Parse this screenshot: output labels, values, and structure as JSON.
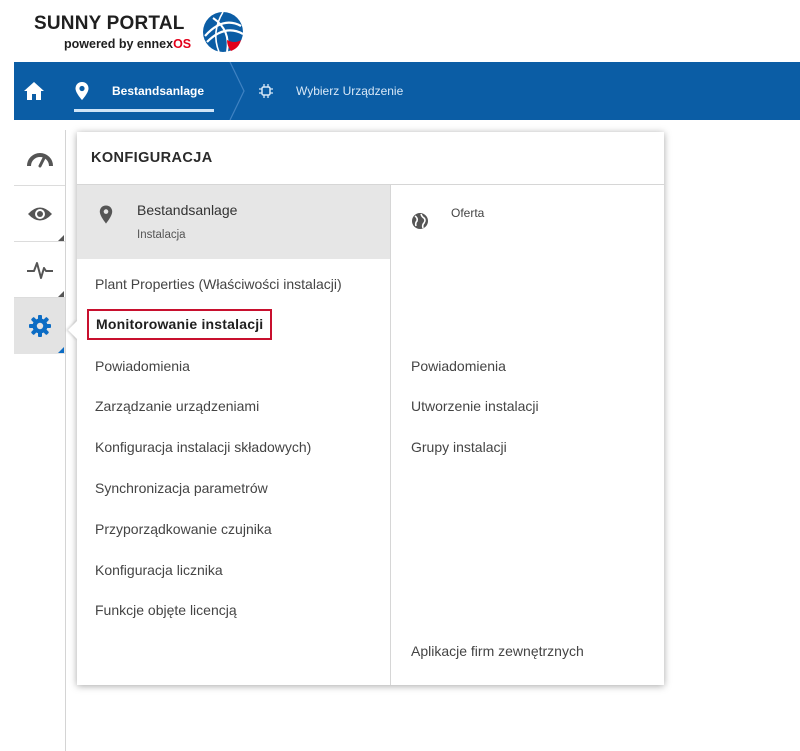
{
  "logo": {
    "title": "SUNNY PORTAL",
    "subtitle_prefix": "powered by ennex",
    "subtitle_suffix": "OS"
  },
  "topnav": {
    "home_icon": "home-icon",
    "breadcrumb": [
      {
        "label": "Bestandsanlage",
        "icon": "location-pin-icon",
        "active": true
      },
      {
        "label": "Wybierz Urządzenie",
        "icon": "device-chip-icon",
        "active": false
      }
    ]
  },
  "rail": {
    "items": [
      {
        "icon": "dashboard-gauge-icon",
        "active": false
      },
      {
        "icon": "eye-icon",
        "active": false
      },
      {
        "icon": "pulse-icon",
        "active": false
      },
      {
        "icon": "gear-icon",
        "active": true
      }
    ]
  },
  "popup": {
    "title": "KONFIGURACJA",
    "plant": {
      "name": "Bestandsanlage",
      "type": "Instalacja"
    },
    "left_items": [
      "Plant Properties (Właściwości instalacji)",
      "Monitorowanie instalacji",
      "Powiadomienia",
      "Zarządzanie urządzeniami",
      "Konfiguracja instalacji składowych)",
      "Synchronizacja parametrów",
      "Przyporządkowanie czujnika",
      "Konfiguracja licznika",
      "Funkcje objęte licencją"
    ],
    "highlighted_index": 1,
    "offer": {
      "label": "Oferta",
      "icon": "globe-icon"
    },
    "right_items": [
      "Powiadomienia",
      "Utworzenie instalacji",
      "Grupy instalacji",
      "Aplikacje firm zewnętrznych"
    ]
  },
  "colors": {
    "nav_blue": "#0b5da5",
    "accent_blue": "#0b6cc4",
    "highlight_red": "#c8102e",
    "logo_red": "#e2001a"
  }
}
